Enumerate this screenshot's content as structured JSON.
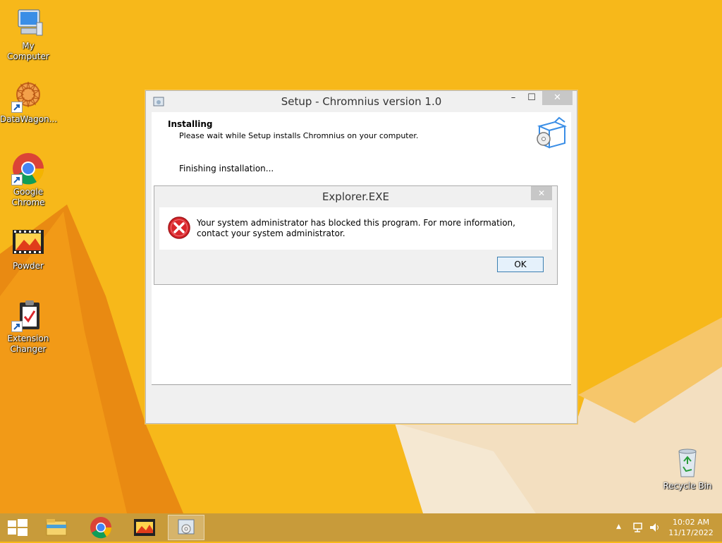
{
  "desktop": {
    "icons": [
      {
        "label": "My Computer"
      },
      {
        "label": "DataWagon..."
      },
      {
        "label": "Google Chrome"
      },
      {
        "label": "Powder"
      },
      {
        "label": "Extension Changer"
      },
      {
        "label": "Recycle Bin"
      }
    ]
  },
  "setup_window": {
    "title": "Setup - Chromnius version 1.0",
    "minimize": "–",
    "maximize": "☐",
    "close": "✕",
    "header_title": "Installing",
    "header_subtitle": "Please wait while Setup installs Chromnius on your computer.",
    "status": "Finishing installation..."
  },
  "error_dialog": {
    "title": "Explorer.EXE",
    "close": "✕",
    "message": "Your system administrator has blocked this program. For more information, contact your system administrator.",
    "ok_label": "OK"
  },
  "taskbar": {
    "items": [
      "start",
      "file-explorer",
      "google-chrome",
      "powder",
      "setup"
    ],
    "clock_time": "10:02 AM",
    "clock_date": "11/17/2022",
    "tray_chevron": "▲"
  },
  "colors": {
    "desktop_bg": "#f7b81a",
    "taskbar": "#c89b3a",
    "error_red": "#d9262b",
    "ok_border": "#3c7fb1"
  }
}
